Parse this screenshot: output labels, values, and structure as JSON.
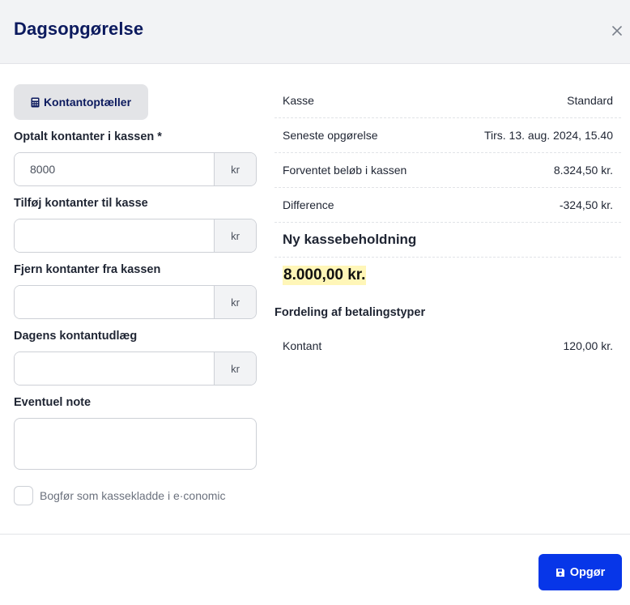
{
  "dialog": {
    "title": "Dagsopgørelse"
  },
  "counter_button": {
    "label": "Kontantoptæller"
  },
  "form": {
    "counted": {
      "label": "Optalt kontanter i kassen *",
      "value": "8000",
      "unit": "kr"
    },
    "add": {
      "label": "Tilføj kontanter til kasse",
      "value": "",
      "unit": "kr"
    },
    "remove": {
      "label": "Fjern kontanter fra kassen",
      "value": "",
      "unit": "kr"
    },
    "expense": {
      "label": "Dagens kontantudlæg",
      "value": "",
      "unit": "kr"
    },
    "note": {
      "label": "Eventuel note",
      "value": ""
    },
    "bookkeep": {
      "label": "Bogfør som kassekladde i e·conomic",
      "checked": false
    }
  },
  "summary": {
    "rows": [
      {
        "label": "Kasse",
        "value": "Standard"
      },
      {
        "label": "Seneste opgørelse",
        "value": "Tirs. 13. aug. 2024, 15.40"
      },
      {
        "label": "Forventet beløb i kassen",
        "value": "8.324,50 kr."
      },
      {
        "label": "Difference",
        "value": "-324,50 kr."
      }
    ],
    "new_balance_label": "Ny kassebeholdning",
    "new_balance_value": "8.000,00 kr."
  },
  "payment_types": {
    "title": "Fordeling af betalingstyper",
    "rows": [
      {
        "label": "Kontant",
        "value": "120,00 kr."
      }
    ]
  },
  "submit_button": {
    "label": "Opgør"
  },
  "colors": {
    "primary": "#0736e8",
    "title": "#0c1a5e",
    "highlight": "#fff6b8"
  }
}
